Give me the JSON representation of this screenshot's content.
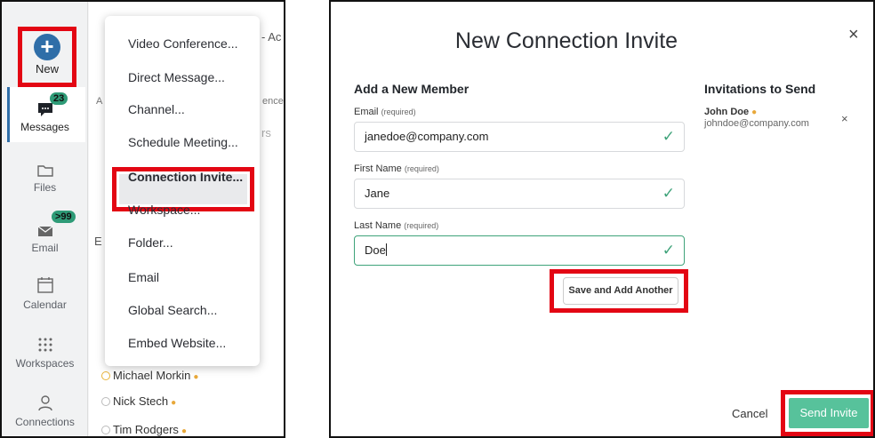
{
  "sidebar": {
    "new_label": "New",
    "items": [
      {
        "label": "Messages",
        "badge": "23",
        "icon": "chat-bubble-icon"
      },
      {
        "label": "Files",
        "icon": "folder-icon"
      },
      {
        "label": "Email",
        "badge": ">99",
        "icon": "envelope-icon"
      },
      {
        "label": "Calendar",
        "icon": "calendar-icon"
      },
      {
        "label": "Workspaces",
        "icon": "grid-icon"
      },
      {
        "label": "Connections",
        "icon": "person-icon"
      }
    ]
  },
  "background_peek": {
    "top_right": "- Ac",
    "side_a": "A",
    "partial": "ence",
    "partial2": "rs",
    "partial3": "E"
  },
  "new_menu": {
    "items": [
      "Video Conference...",
      "Direct Message...",
      "Channel...",
      "Schedule Meeting...",
      "Connection Invite...",
      "Workspace...",
      "Folder...",
      "Email",
      "Global Search...",
      "Embed Website..."
    ]
  },
  "contacts": [
    "Michael Morkin",
    "Nick Stech",
    "Tim Rodgers"
  ],
  "dialog": {
    "title": "New Connection Invite",
    "close": "×",
    "add_heading": "Add a New Member",
    "invitations_heading": "Invitations to Send",
    "email_label": "Email",
    "first_label": "First Name",
    "last_label": "Last Name",
    "required_text": "(required)",
    "email_value": "janedoe@company.com",
    "first_value": "Jane",
    "last_value": "Doe",
    "save_button": "Save and Add Another",
    "invitee_name": "John Doe",
    "invitee_email": "johndoe@company.com",
    "remove": "×",
    "cancel": "Cancel",
    "send_button": "Send Invite"
  },
  "colors": {
    "highlight": "#e30613",
    "accent": "#2f6ea8",
    "success": "#57c29b"
  }
}
